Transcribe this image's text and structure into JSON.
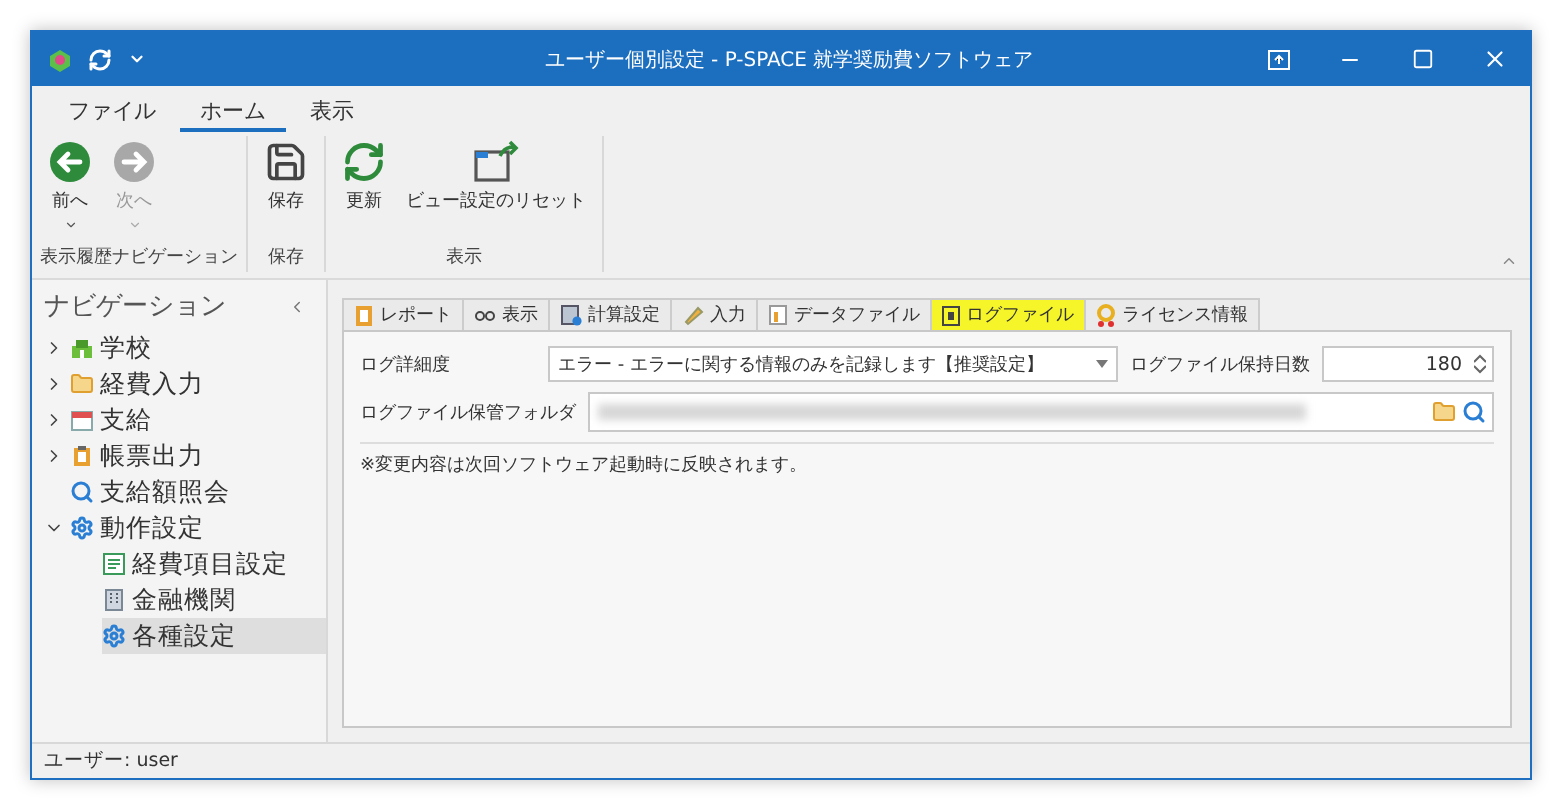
{
  "window": {
    "title": "ユーザー個別設定 - P-SPACE 就学奨励費ソフトウェア"
  },
  "ribbon": {
    "tabs": [
      {
        "label": "ファイル",
        "selected": false
      },
      {
        "label": "ホーム",
        "selected": true
      },
      {
        "label": "表示",
        "selected": false
      }
    ],
    "groups": [
      {
        "label": "表示履歴ナビゲーション",
        "buttons": [
          {
            "label": "前へ",
            "disabled": false
          },
          {
            "label": "次へ",
            "disabled": true
          }
        ]
      },
      {
        "label": "保存",
        "buttons": [
          {
            "label": "保存",
            "disabled": false
          }
        ]
      },
      {
        "label": "表示",
        "buttons": [
          {
            "label": "更新",
            "disabled": false
          },
          {
            "label": "ビュー設定のリセット",
            "disabled": false
          }
        ]
      }
    ]
  },
  "sidebar": {
    "title": "ナビゲーション",
    "items": [
      {
        "label": "学校",
        "kind": "folder",
        "expanded": false,
        "selected": false
      },
      {
        "label": "経費入力",
        "kind": "folder",
        "expanded": false,
        "selected": false
      },
      {
        "label": "支給",
        "kind": "folder",
        "expanded": false,
        "selected": false
      },
      {
        "label": "帳票出力",
        "kind": "folder",
        "expanded": false,
        "selected": false
      },
      {
        "label": "支給額照会",
        "kind": "item",
        "selected": false
      },
      {
        "label": "動作設定",
        "kind": "folder",
        "expanded": true,
        "selected": false,
        "children": [
          {
            "label": "経費項目設定",
            "selected": false
          },
          {
            "label": "金融機関",
            "selected": false
          },
          {
            "label": "各種設定",
            "selected": true
          }
        ]
      }
    ]
  },
  "tabs": [
    {
      "label": "レポート",
      "selected": false
    },
    {
      "label": "表示",
      "selected": false
    },
    {
      "label": "計算設定",
      "selected": false
    },
    {
      "label": "入力",
      "selected": false
    },
    {
      "label": "データファイル",
      "selected": false
    },
    {
      "label": "ログファイル",
      "selected": true
    },
    {
      "label": "ライセンス情報",
      "selected": false
    }
  ],
  "form": {
    "log_level": {
      "label": "ログ詳細度",
      "value": "エラー - エラーに関する情報のみを記録します【推奨設定】"
    },
    "retention_days": {
      "label": "ログファイル保持日数",
      "value": "180"
    },
    "folder": {
      "label": "ログファイル保管フォルダ"
    },
    "note": "※変更内容は次回ソフトウェア起動時に反映されます。"
  },
  "status_bar": {
    "user": "ユーザー: user"
  }
}
